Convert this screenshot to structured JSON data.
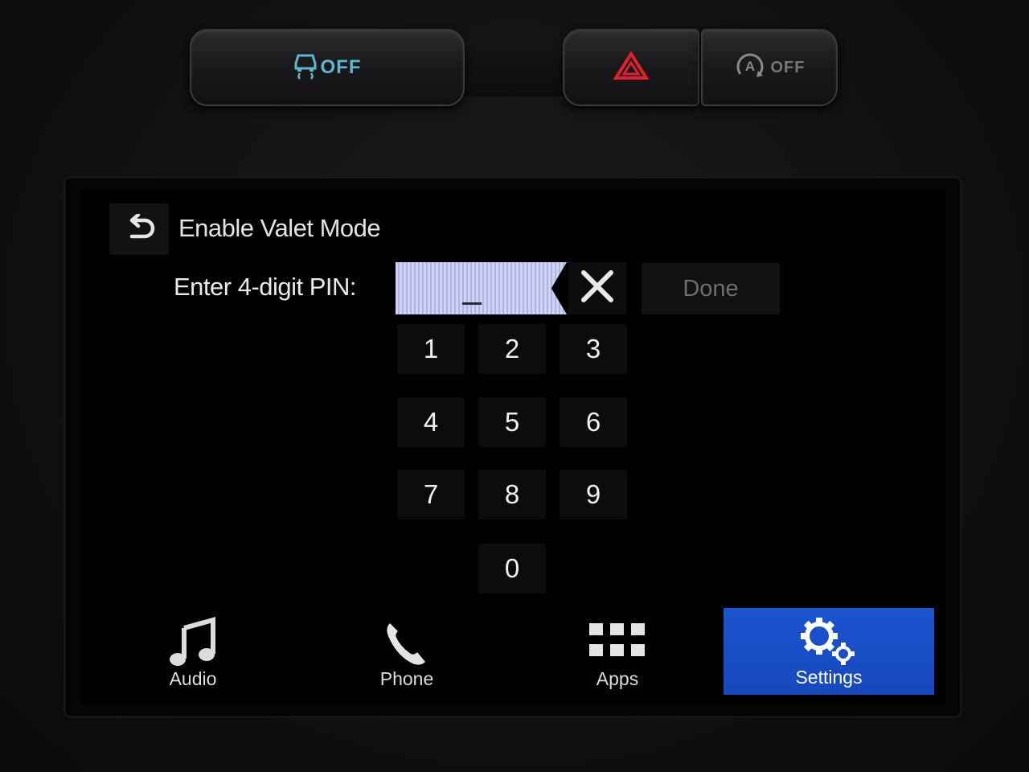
{
  "hardware": {
    "traction_off_label": "OFF",
    "autostop_off_label": "OFF",
    "accent_color": "#5bb8cf",
    "hazard_color": "#e0202a"
  },
  "screen": {
    "title": "Enable Valet Mode",
    "back_icon": "back-arrow-icon",
    "pin_label": "Enter 4-digit PIN:",
    "pin_value": "",
    "clear_icon": "close-icon",
    "done_label": "Done",
    "keypad": [
      "1",
      "2",
      "3",
      "4",
      "5",
      "6",
      "7",
      "8",
      "9",
      "0"
    ]
  },
  "nav": {
    "items": [
      {
        "label": "Audio",
        "icon": "music-note-icon"
      },
      {
        "label": "Phone",
        "icon": "phone-icon"
      },
      {
        "label": "Apps",
        "icon": "apps-grid-icon"
      },
      {
        "label": "Settings",
        "icon": "gears-icon",
        "active": true
      }
    ],
    "active_color": "#1b54cf"
  }
}
